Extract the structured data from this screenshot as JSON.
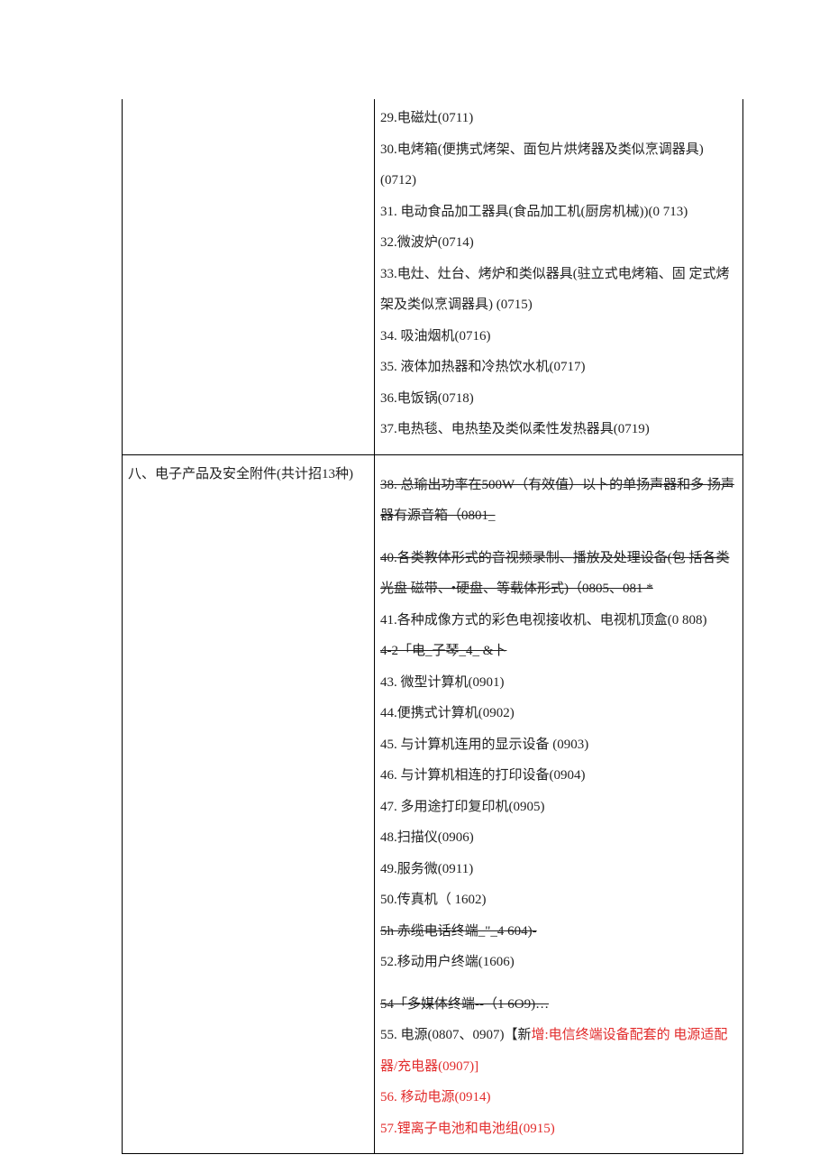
{
  "row1": {
    "left": "",
    "items": [
      {
        "text": "29.电磁灶(0711)"
      },
      {
        "text": "30.电烤箱(便携式烤架、面包片烘烤器及类似烹调器具)(0712)"
      },
      {
        "text": "31. 电动食品加工器具(食品加工机(厨房机械))(0 713)"
      },
      {
        "text": "32.微波炉(0714)"
      },
      {
        "text": "33.电灶、灶台、烤炉和类似器具(驻立式电烤箱、固 定式烤架及类似烹调器具) (0715)"
      },
      {
        "text": "34. 吸油烟机(0716)"
      },
      {
        "text": "35. 液体加热器和冷热饮水机(0717)"
      },
      {
        "text": "36.电饭锅(0718)"
      },
      {
        "text": "37.电热毯、电热垫及类似柔性发热器具(0719)"
      }
    ]
  },
  "row2": {
    "left": "八、电子产品及安全附件(共计招13种)",
    "items": [
      {
        "text": "38. 总瑜出功率在500W（有效值）以卜的单扬声器和多 扬声器有源音箱（0801_",
        "struck": true,
        "gapBefore": true
      },
      {
        "text": "40.各类教体形式的音视频录制、播放及处理设备(包 括各类光盘 磁带、•硬盘、等载体形式)（0805、081 *",
        "struck": true,
        "gapBefore": true
      },
      {
        "text": "41.各种成像方式的彩色电视接收机、电视机顶盒(0 808)"
      },
      {
        "text": "4-2「电_子琴_4_ &卜",
        "struck": true
      },
      {
        "text": "43. 微型计算机(0901)"
      },
      {
        "text": "44.便携式计算机(0902)"
      },
      {
        "text": "45. 与计算机连用的显示设备 (0903)"
      },
      {
        "text": "46. 与计算机相连的打印设备(0904)"
      },
      {
        "text": "47. 多用途打印复印机(0905)"
      },
      {
        "text": "48.扫描仪(0906)"
      },
      {
        "text": "49.服务微(0911)"
      },
      {
        "text": "50.传真机（ 1602)"
      },
      {
        "text": "5h 赤缆电话终端_\"_4 604)-",
        "struck": true
      },
      {
        "text": "52.移动用户终端(1606)"
      },
      {
        "text": "54「多媒体终端--（1 6O9)…",
        "struck": true,
        "gapBefore": true
      },
      {
        "text": "55. 电源(0807、0907)【新",
        "append_red": "增:电信终端设备配套的 电源适配器/充电器(0907)]"
      },
      {
        "text": "56. 移动电源(0914)",
        "red": true
      },
      {
        "text": "57.锂离子电池和电池组(0915)",
        "red": true
      }
    ]
  }
}
